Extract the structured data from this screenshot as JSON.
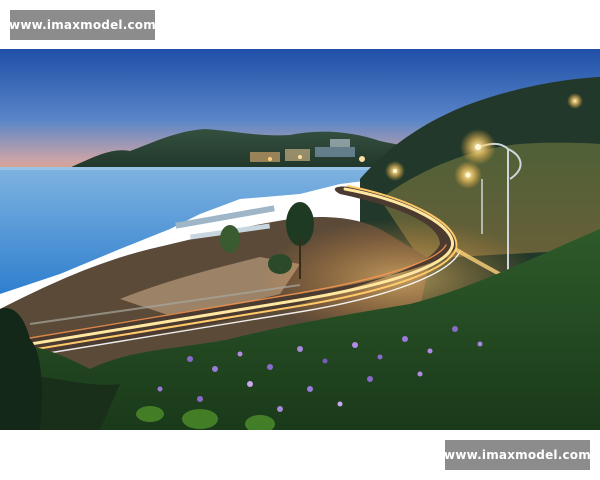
{
  "watermark": {
    "top_text": "www.imaxmodel.com",
    "bottom_text": "www.imaxmodel.com"
  },
  "photo": {
    "subject": "coastal-road-light-trails-dusk",
    "colors": {
      "sky_top": "#1f4fa8",
      "sky_bottom": "#e8a27a",
      "sea": "#3d8fd6",
      "light_trail": "#ffd27a",
      "hill": "#2f4a3a",
      "vegetation": "#2e5a2a",
      "flowers": "#8a6bc9"
    }
  }
}
